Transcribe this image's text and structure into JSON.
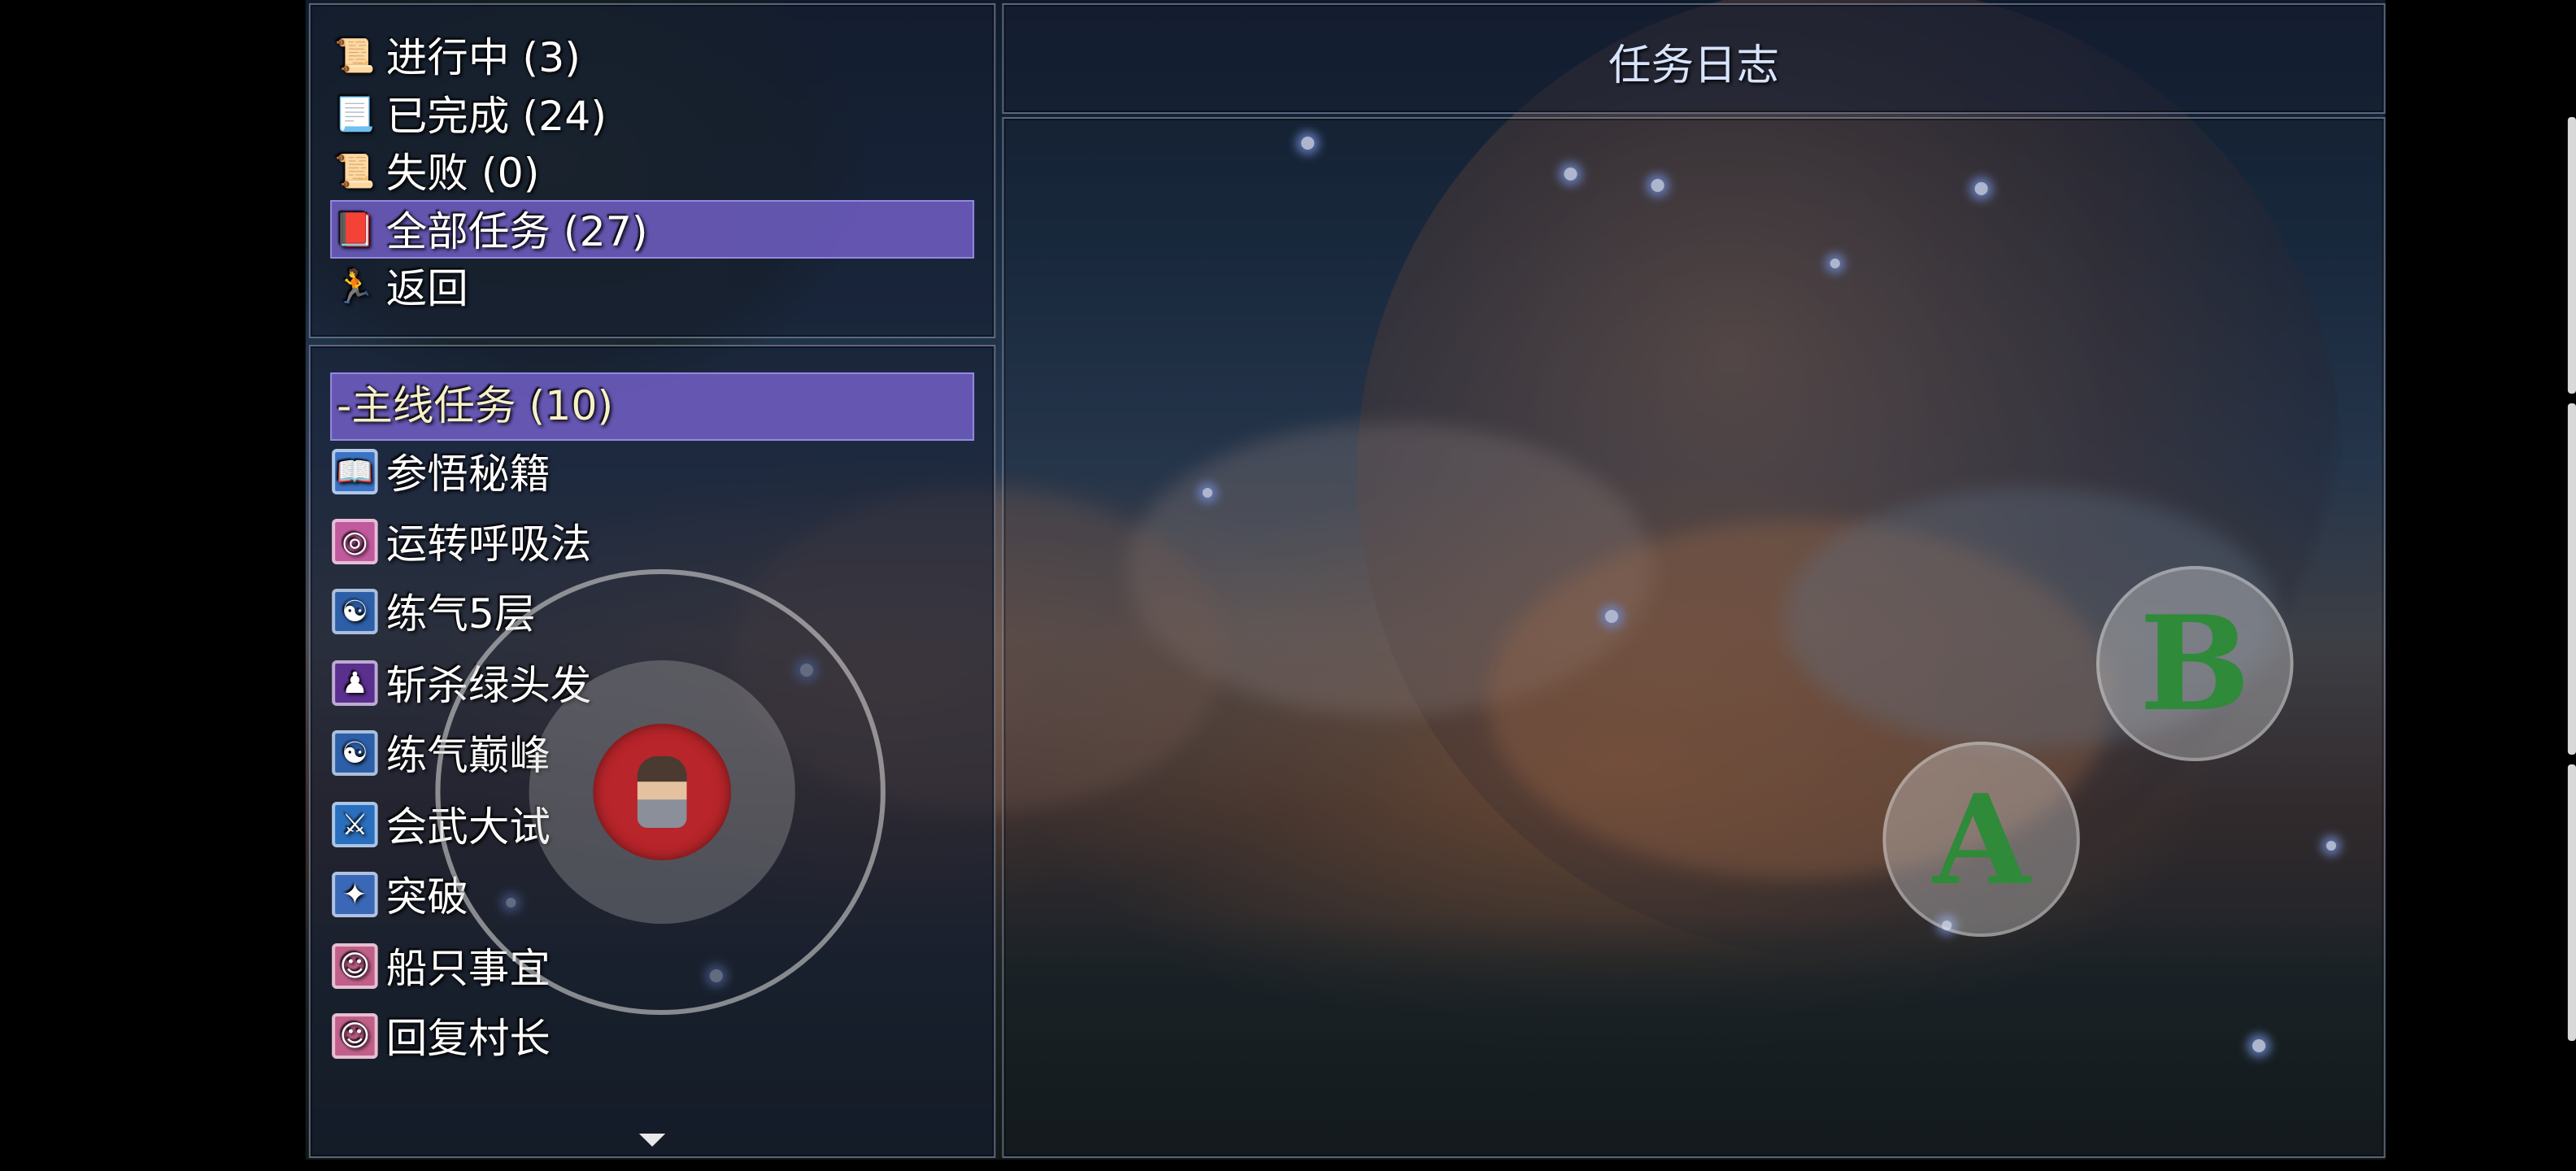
{
  "window_title": "任务日志",
  "category_menu": [
    {
      "label": "进行中 (3)",
      "icon": "scroll-icon"
    },
    {
      "label": "已完成 (24)",
      "icon": "parchment-icon"
    },
    {
      "label": "失败 (0)",
      "icon": "torn-scroll-icon"
    },
    {
      "label": "全部任务 (27)",
      "icon": "book-icon",
      "selected": true
    },
    {
      "label": "返回",
      "icon": "return-icon"
    }
  ],
  "quest_group": {
    "label": "-主线任务 (10)"
  },
  "quests": [
    {
      "label": "参悟秘籍",
      "icon": "open-book-icon",
      "color": "#3b73c4"
    },
    {
      "label": "运转呼吸法",
      "icon": "radiating-figure-icon",
      "color": "#c05a9c"
    },
    {
      "label": "练气5层",
      "icon": "meditation-icon",
      "color": "#2d5fa8"
    },
    {
      "label": "斩杀绿头发",
      "icon": "fighter-icon",
      "color": "#5a2f8e"
    },
    {
      "label": "练气巅峰",
      "icon": "meditation-icon",
      "color": "#2d5fa8"
    },
    {
      "label": "会武大试",
      "icon": "kick-icon",
      "color": "#2a6fbe"
    },
    {
      "label": "突破",
      "icon": "breakthrough-icon",
      "color": "#3b68b6"
    },
    {
      "label": "船只事宜",
      "icon": "talk-icon",
      "color": "#c0608a"
    },
    {
      "label": "回复村长",
      "icon": "talk-icon",
      "color": "#c0608a"
    }
  ],
  "controls": {
    "button_a": "A",
    "button_b": "B",
    "joystick": "virtual-joystick"
  },
  "colors": {
    "selection": "#7a64d2",
    "window_bg": "#161e34",
    "button_letter": "#2f8a3a",
    "joystick_knob": "#b8252a"
  }
}
